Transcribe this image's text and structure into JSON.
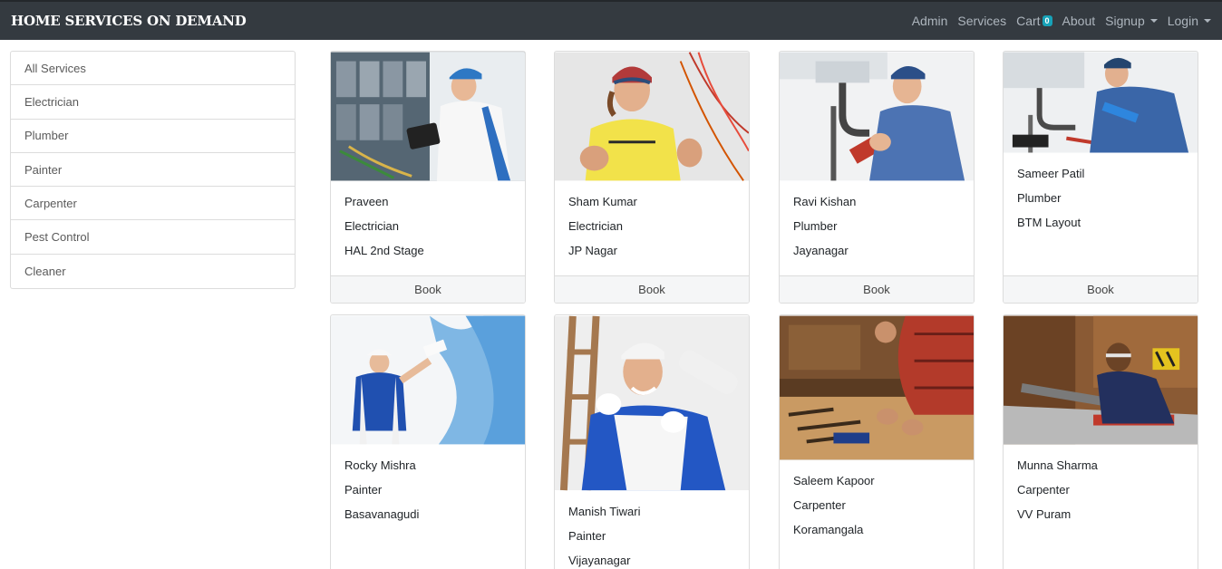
{
  "navbar": {
    "brand": "HOME SERVICES ON DEMAND",
    "links": {
      "admin": "Admin",
      "services": "Services",
      "cart": "Cart",
      "cart_count": "0",
      "about": "About",
      "signup": "Signup",
      "login": "Login"
    }
  },
  "sidebar": {
    "items": [
      {
        "label": "All Services"
      },
      {
        "label": "Electrician"
      },
      {
        "label": "Plumber"
      },
      {
        "label": "Painter"
      },
      {
        "label": "Carpenter"
      },
      {
        "label": "Pest Control"
      },
      {
        "label": "Cleaner"
      }
    ]
  },
  "book_label": "Book",
  "cards": [
    {
      "name": "Praveen",
      "service": "Electrician",
      "location": "HAL 2nd Stage",
      "image_icon": "electrician-photo"
    },
    {
      "name": "Sham Kumar",
      "service": "Electrician",
      "location": "JP Nagar",
      "image_icon": "electrician-photo"
    },
    {
      "name": "Ravi Kishan",
      "service": "Plumber",
      "location": "Jayanagar",
      "image_icon": "plumber-photo"
    },
    {
      "name": "Sameer Patil",
      "service": "Plumber",
      "location": "BTM Layout",
      "image_icon": "plumber-photo"
    },
    {
      "name": "Rocky Mishra",
      "service": "Painter",
      "location": "Basavanagudi",
      "image_icon": "painter-photo"
    },
    {
      "name": "Manish Tiwari",
      "service": "Painter",
      "location": "Vijayanagar",
      "image_icon": "painter-photo"
    },
    {
      "name": "Saleem Kapoor",
      "service": "Carpenter",
      "location": "Koramangala",
      "image_icon": "carpenter-photo"
    },
    {
      "name": "Munna Sharma",
      "service": "Carpenter",
      "location": "VV Puram",
      "image_icon": "carpenter-photo"
    }
  ]
}
